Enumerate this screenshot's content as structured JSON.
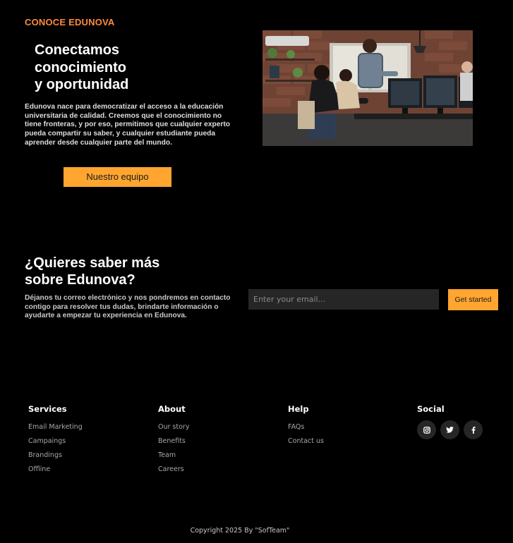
{
  "about": {
    "eyebrow": "CONOCE EDUNOVA",
    "title_lines": [
      "Conectamos",
      "conocimiento",
      "y oportunidad"
    ],
    "description": "Edunova nace para democratizar el acceso a la educación universitaria de calidad. Creemos que el conocimiento no tiene fronteras, y por eso, permitimos que cualquier experto pueda compartir su saber, y cualquier estudiante pueda aprender desde cualquier parte del mundo.",
    "team_button_label": "Nuestro equipo",
    "image_icon": "team-working-photo"
  },
  "cta": {
    "title_lines": [
      "¿Quieres saber más",
      "sobre Edunova?"
    ],
    "description": "Déjanos tu correo electrónico y nos pondremos en contacto contigo para resolver tus dudas, brindarte información o ayudarte a empezar tu experiencia en Edunova.",
    "email_placeholder": "Enter your email...",
    "email_value": "",
    "button_label": "Get started"
  },
  "footer": {
    "services": {
      "heading": "Services",
      "links": [
        "Email Marketing",
        "Campaings",
        "Brandings",
        "Offline"
      ]
    },
    "about": {
      "heading": "About",
      "links": [
        "Our story",
        "Benefits",
        "Team",
        "Careers"
      ]
    },
    "help": {
      "heading": "Help",
      "links": [
        "FAQs",
        "Contact us"
      ]
    },
    "social": {
      "heading": "Social",
      "icons": [
        "instagram-icon",
        "twitter-icon",
        "facebook-icon"
      ]
    },
    "copyright": "Copyright 2025 By \"SofTeam\""
  },
  "colors": {
    "background": "#000000",
    "accent": "#ffa530",
    "eyebrow": "#ff8a3d",
    "input_bg": "#262626",
    "muted_text": "#a8a8a8"
  }
}
